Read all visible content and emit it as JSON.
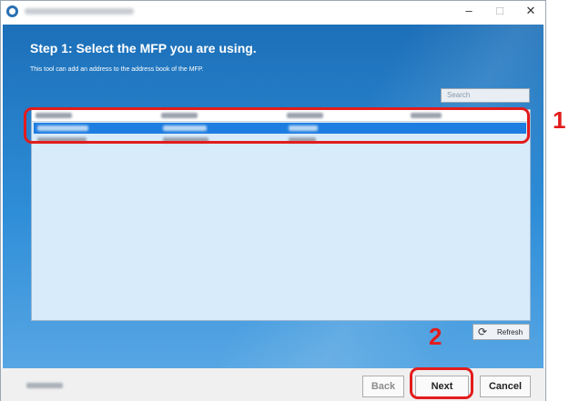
{
  "window": {
    "controls": {
      "minimize": "–",
      "maximize": "□",
      "close": "✕"
    },
    "app_icon": "app-logo-icon"
  },
  "main": {
    "step_title": "Step 1: Select the MFP you are using.",
    "description": "This tool can add an address to the address book of the MFP.",
    "search_placeholder": "Search",
    "refresh_label": "Refresh",
    "refresh_icon": "refresh-icon"
  },
  "annotations": {
    "callout_1": "1",
    "callout_2": "2",
    "callout_color": "#e31c1c"
  },
  "footer": {
    "back_label": "Back",
    "next_label": "Next",
    "cancel_label": "Cancel"
  },
  "colors": {
    "background_top": "#1c6fb8",
    "background_bottom": "#57a6e3",
    "selected_row": "#1e7de0",
    "list_background": "#d7ebfb"
  }
}
